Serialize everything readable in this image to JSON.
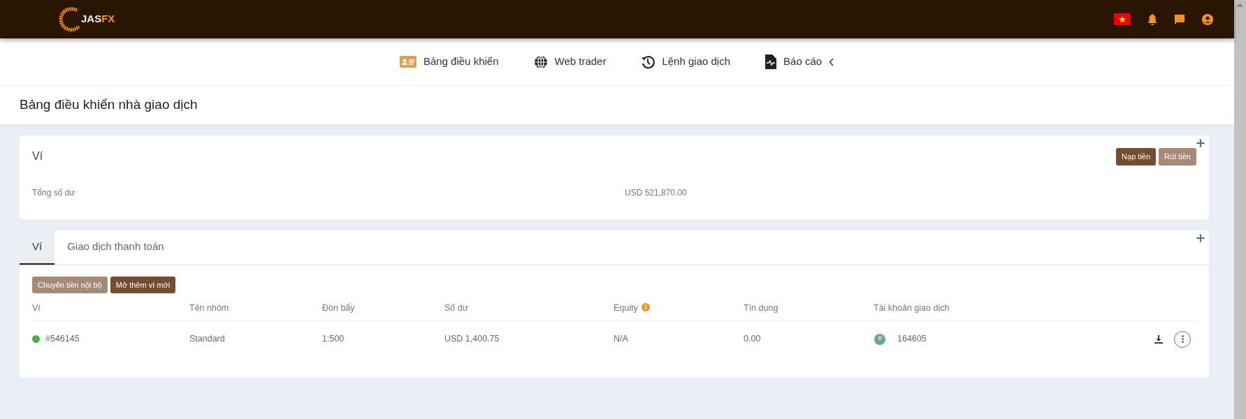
{
  "header": {
    "logo": {
      "main": "JAS",
      "accent": "FX"
    }
  },
  "nav": [
    {
      "label": "Bảng điều khiển",
      "kind": "dashboard",
      "selected": false
    },
    {
      "label": "Web trader",
      "kind": "globe",
      "selected": false
    },
    {
      "label": "Lệnh giao dịch",
      "kind": "history",
      "selected": false
    },
    {
      "label": "Báo cáo",
      "kind": "report",
      "selected": false,
      "expandable": true
    }
  ],
  "page_title": "Bảng điều khiển nhà giao dịch",
  "wallet_card": {
    "title": "Ví",
    "buttons": [
      {
        "label": "Nạp tiền",
        "kind": "primary"
      },
      {
        "label": "Rút tiền",
        "kind": "secondary"
      }
    ],
    "balance_label": "Tổng số dư",
    "balance_value": "USD 521,870.00"
  },
  "tabs": [
    {
      "label": "Ví",
      "selected": true
    },
    {
      "label": "Giao dịch thanh toán",
      "selected": false
    }
  ],
  "actions": [
    {
      "label": "Chuyển tiền nội bộ",
      "kind": "secondary"
    },
    {
      "label": "Mở thêm ví mới",
      "kind": "primary"
    }
  ],
  "table": {
    "columns": [
      {
        "label": "Ví"
      },
      {
        "label": "Tên nhóm"
      },
      {
        "label": "Đòn bẩy"
      },
      {
        "label": "Số dư"
      },
      {
        "label": "Equity",
        "info": true
      },
      {
        "label": "Tín dụng"
      },
      {
        "label": "Tài khoản giao dịch"
      }
    ],
    "rows": [
      {
        "wallet": "#546145",
        "color": "#4caf50",
        "group": "Standard",
        "leverage": "1:500",
        "balance": "USD 1,400.75",
        "equity": "N/A",
        "credit": "0.00",
        "account": "164605"
      }
    ]
  }
}
